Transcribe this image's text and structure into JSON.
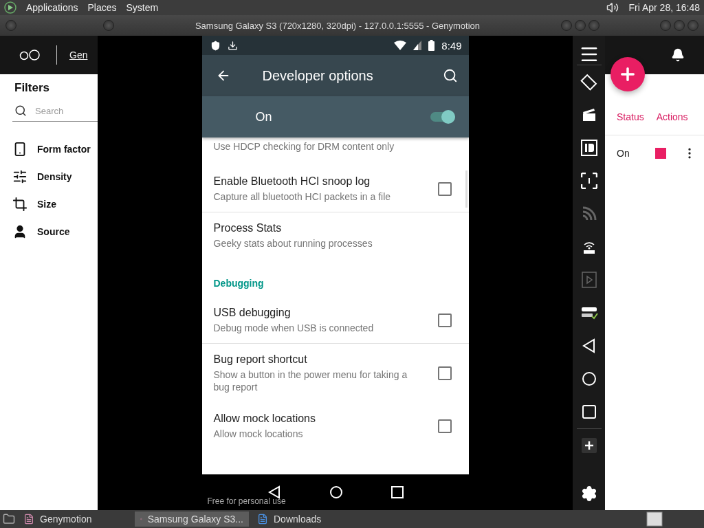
{
  "top_panel": {
    "menus": [
      {
        "label": "Applications"
      },
      {
        "label": "Places"
      },
      {
        "label": "System"
      }
    ],
    "clock": "Fri Apr 28, 16:48"
  },
  "app_window": {
    "nav_link": "Gen",
    "filters_title": "Filters",
    "search": {
      "placeholder": "Search"
    },
    "filters": [
      {
        "label": "Form factor",
        "kind": "phone"
      },
      {
        "label": "Density",
        "kind": "sliders"
      },
      {
        "label": "Size",
        "kind": "crop"
      },
      {
        "label": "Source",
        "kind": "person"
      }
    ],
    "columns": [
      "Status",
      "Actions"
    ],
    "row": {
      "status": "On"
    }
  },
  "emulator": {
    "title": "Samsung Galaxy S3 (720x1280, 320dpi) - 127.0.0.1:5555 - Genymotion",
    "time": "8:49",
    "screen_title": "Developer options",
    "master": {
      "label": "On",
      "on": true
    },
    "list": [
      {
        "kind": "plain",
        "subtitle": "Use HDCP checking for DRM content only",
        "divider": false
      },
      {
        "kind": "checkbox",
        "title": "Enable Bluetooth HCI snoop log",
        "subtitle": "Capture all bluetooth HCI packets in a file",
        "checked": false,
        "divider": true
      },
      {
        "kind": "plain",
        "title": "Process Stats",
        "subtitle": "Geeky stats about running processes",
        "divider": false
      },
      {
        "kind": "category",
        "title": "Debugging"
      },
      {
        "kind": "checkbox",
        "title": "USB debugging",
        "subtitle": "Debug mode when USB is connected",
        "checked": false,
        "divider": true
      },
      {
        "kind": "checkbox",
        "title": "Bug report shortcut",
        "subtitle": "Show a button in the power menu for taking a bug report",
        "checked": false,
        "divider": false
      },
      {
        "kind": "checkbox",
        "title": "Allow mock locations",
        "subtitle": "Allow mock locations",
        "checked": false,
        "divider": false
      }
    ],
    "footer_note": "Free for personal use"
  },
  "taskbar": [
    {
      "label": "Genymotion",
      "selected": false
    },
    {
      "label": "Samsung Galaxy S3...",
      "selected": true
    },
    {
      "label": "Downloads",
      "selected": false
    }
  ]
}
